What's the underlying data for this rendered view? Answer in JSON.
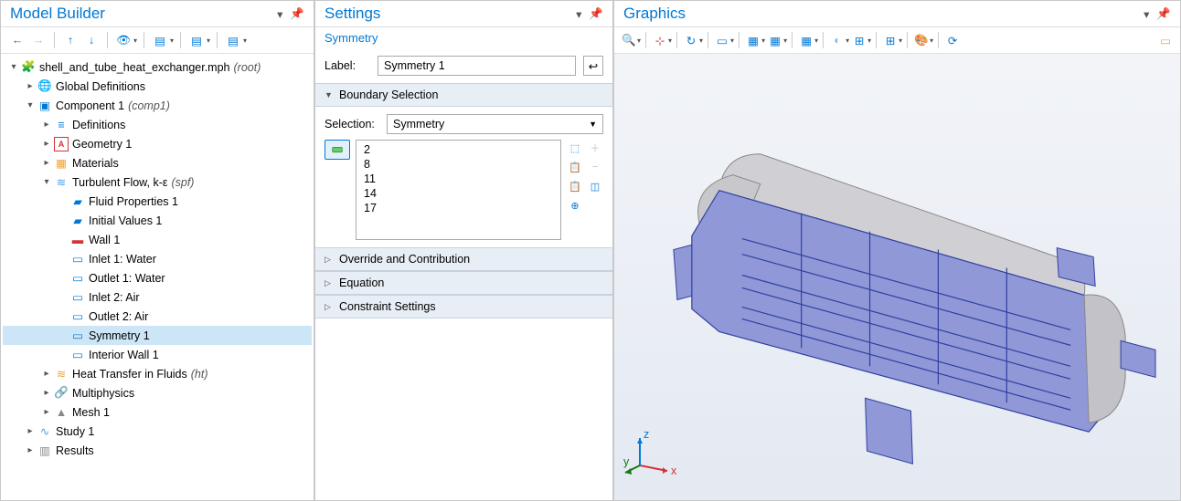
{
  "modelBuilder": {
    "title": "Model Builder",
    "tree": {
      "root": {
        "label": "shell_and_tube_heat_exchanger.mph",
        "tag": "(root)"
      },
      "globalDefs": {
        "label": "Global Definitions"
      },
      "comp1": {
        "label": "Component 1",
        "tag": "(comp1)"
      },
      "defs": {
        "label": "Definitions"
      },
      "geom": {
        "label": "Geometry 1"
      },
      "mats": {
        "label": "Materials"
      },
      "turb": {
        "label": "Turbulent Flow, k-ε",
        "tag": "(spf)"
      },
      "fluidProps": {
        "label": "Fluid Properties 1"
      },
      "initVals": {
        "label": "Initial Values 1"
      },
      "wall1": {
        "label": "Wall 1"
      },
      "inlet1": {
        "label": "Inlet 1: Water"
      },
      "outlet1": {
        "label": "Outlet 1: Water"
      },
      "inlet2": {
        "label": "Inlet 2: Air"
      },
      "outlet2": {
        "label": "Outlet 2: Air"
      },
      "sym1": {
        "label": "Symmetry 1"
      },
      "intWall": {
        "label": "Interior Wall 1"
      },
      "heatTrans": {
        "label": "Heat Transfer in Fluids",
        "tag": "(ht)"
      },
      "multiphys": {
        "label": "Multiphysics"
      },
      "mesh": {
        "label": "Mesh 1"
      },
      "study": {
        "label": "Study 1"
      },
      "results": {
        "label": "Results"
      }
    }
  },
  "settings": {
    "title": "Settings",
    "subtitle": "Symmetry",
    "labelField": {
      "label": "Label:",
      "value": "Symmetry 1"
    },
    "boundarySel": {
      "header": "Boundary Selection",
      "selLabel": "Selection:",
      "selValue": "Symmetry",
      "items": [
        "2",
        "8",
        "11",
        "14",
        "17"
      ]
    },
    "sections": {
      "override": "Override and Contribution",
      "equation": "Equation",
      "constraint": "Constraint Settings"
    }
  },
  "graphics": {
    "title": "Graphics",
    "axes": {
      "x": "x",
      "y": "y",
      "z": "z"
    }
  }
}
